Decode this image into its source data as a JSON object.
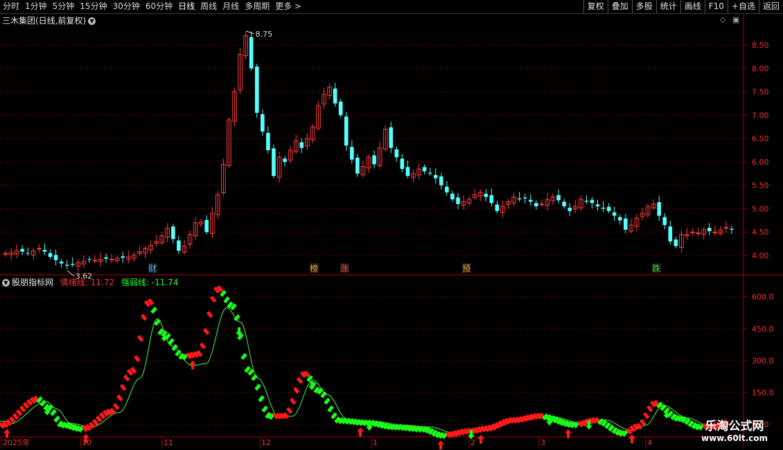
{
  "toolbar": {
    "tabs": [
      "分时",
      "1分钟",
      "5分钟",
      "15分钟",
      "30分钟",
      "60分钟",
      "日线",
      "周线",
      "月线",
      "多周期",
      "更多 >"
    ],
    "active_tab": "日线",
    "buttons": [
      "复权",
      "叠加",
      "多股",
      "统计",
      "画线",
      "F10",
      "+自选",
      "返回"
    ]
  },
  "main": {
    "title": "三木集团(日线,前复权)",
    "high_label": "8.75",
    "low_label": "3.62",
    "y_ticks": [
      "8.50",
      "8.00",
      "7.50",
      "7.00",
      "6.50",
      "6.00",
      "5.50",
      "5.00",
      "4.50",
      "4.00"
    ],
    "event_markers": [
      {
        "text": "财",
        "color": "#4aa8ff"
      },
      {
        "text": "榜",
        "color": "#f0a030"
      },
      {
        "text": "涨",
        "color": "#ff4040"
      },
      {
        "text": "预",
        "color": "#f0a030"
      },
      {
        "text": "跌",
        "color": "#40d040"
      }
    ]
  },
  "indicator": {
    "name": "股朋指标网",
    "line1_label": "情绪线:",
    "line1_value": "11.72",
    "line2_label": "强弱线:",
    "line2_value": "-11.74",
    "y_ticks": [
      "600.0",
      "450.0",
      "300.0",
      "150.0",
      "0.00"
    ]
  },
  "x_axis": {
    "labels": [
      "2025年",
      "10",
      "11",
      "12",
      "1",
      "2",
      "3",
      "4"
    ]
  },
  "watermark": {
    "title": "乐淘公式网",
    "url": "www.60lt.com"
  },
  "colors": {
    "up": "#ff3c3c",
    "down": "#54ffff",
    "ind_up": "#ff1a1a",
    "ind_down": "#1aff1a",
    "grid": "#7a0000",
    "frame": "#b00000"
  },
  "chart_data": [
    {
      "type": "candlestick",
      "title": "三木集团(日线,前复权)",
      "ylim": [
        3.6,
        8.9
      ],
      "y_ticks": [
        4.0,
        4.5,
        5.0,
        5.5,
        6.0,
        6.5,
        7.0,
        7.5,
        8.0,
        8.5
      ],
      "annotations": [
        {
          "text": "8.75",
          "kind": "high"
        },
        {
          "text": "3.62",
          "kind": "low"
        }
      ],
      "closes": [
        4.05,
        4.06,
        4.1,
        4.08,
        4.04,
        4.1,
        4.15,
        4.08,
        3.97,
        3.9,
        3.83,
        3.78,
        3.8,
        3.85,
        3.88,
        3.91,
        3.9,
        3.92,
        3.93,
        3.92,
        3.94,
        3.95,
        3.97,
        4.0,
        4.08,
        4.15,
        4.22,
        4.3,
        4.42,
        4.58,
        4.35,
        4.1,
        4.2,
        4.45,
        4.7,
        4.72,
        4.5,
        4.9,
        5.3,
        5.95,
        6.9,
        7.5,
        8.3,
        8.7,
        8.0,
        7.05,
        6.65,
        6.25,
        5.7,
        6.1,
        6.0,
        6.25,
        6.45,
        6.3,
        6.5,
        6.75,
        7.2,
        7.45,
        7.6,
        7.25,
        7.0,
        6.35,
        6.05,
        5.75,
        5.9,
        6.1,
        5.95,
        6.3,
        6.7,
        6.3,
        6.1,
        5.85,
        5.7,
        5.75,
        5.85,
        5.8,
        5.75,
        5.65,
        5.5,
        5.35,
        5.2,
        5.1,
        5.15,
        5.2,
        5.3,
        5.35,
        5.25,
        5.12,
        4.95,
        5.05,
        5.15,
        5.25,
        5.2,
        5.22,
        5.15,
        5.05,
        5.1,
        5.2,
        5.25,
        5.18,
        5.05,
        4.95,
        5.05,
        5.2,
        5.15,
        5.12,
        5.05,
        5.0,
        4.95,
        4.85,
        4.75,
        4.55,
        4.65,
        4.8,
        4.9,
        5.05,
        5.1,
        4.85,
        4.65,
        4.3,
        4.2,
        4.45,
        4.45,
        4.5,
        4.48,
        4.55,
        4.52,
        4.5,
        4.55,
        4.6,
        4.55
      ]
    },
    {
      "type": "line",
      "title": "股朋指标网",
      "ylim": [
        -55,
        700
      ],
      "y_ticks": [
        0,
        150,
        300,
        450,
        600
      ],
      "series": [
        {
          "name": "情绪线",
          "last_value": 11.72
        },
        {
          "name": "强弱线",
          "last_value": -11.74
        }
      ]
    }
  ]
}
